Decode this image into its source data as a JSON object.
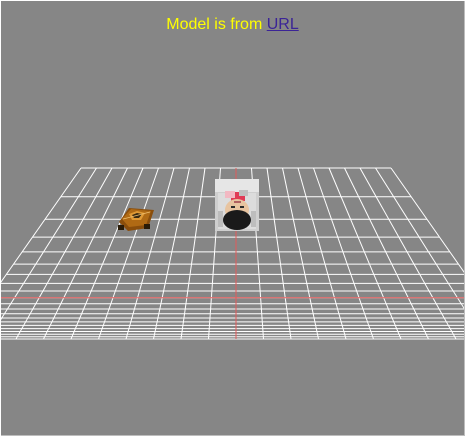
{
  "caption": {
    "prefix": "Model is from ",
    "link_text": "URL"
  },
  "colors": {
    "background": "#868686",
    "caption_text": "#ffff00",
    "link": "#3b2496",
    "grid": "#ffffff",
    "axis": "#e25a5a",
    "car_body": "#b06a14",
    "photo_frame": "#d9d9d9"
  },
  "scene": {
    "grid": "perspective-floor-grid",
    "objects": [
      "car-model",
      "photo-cube"
    ]
  }
}
